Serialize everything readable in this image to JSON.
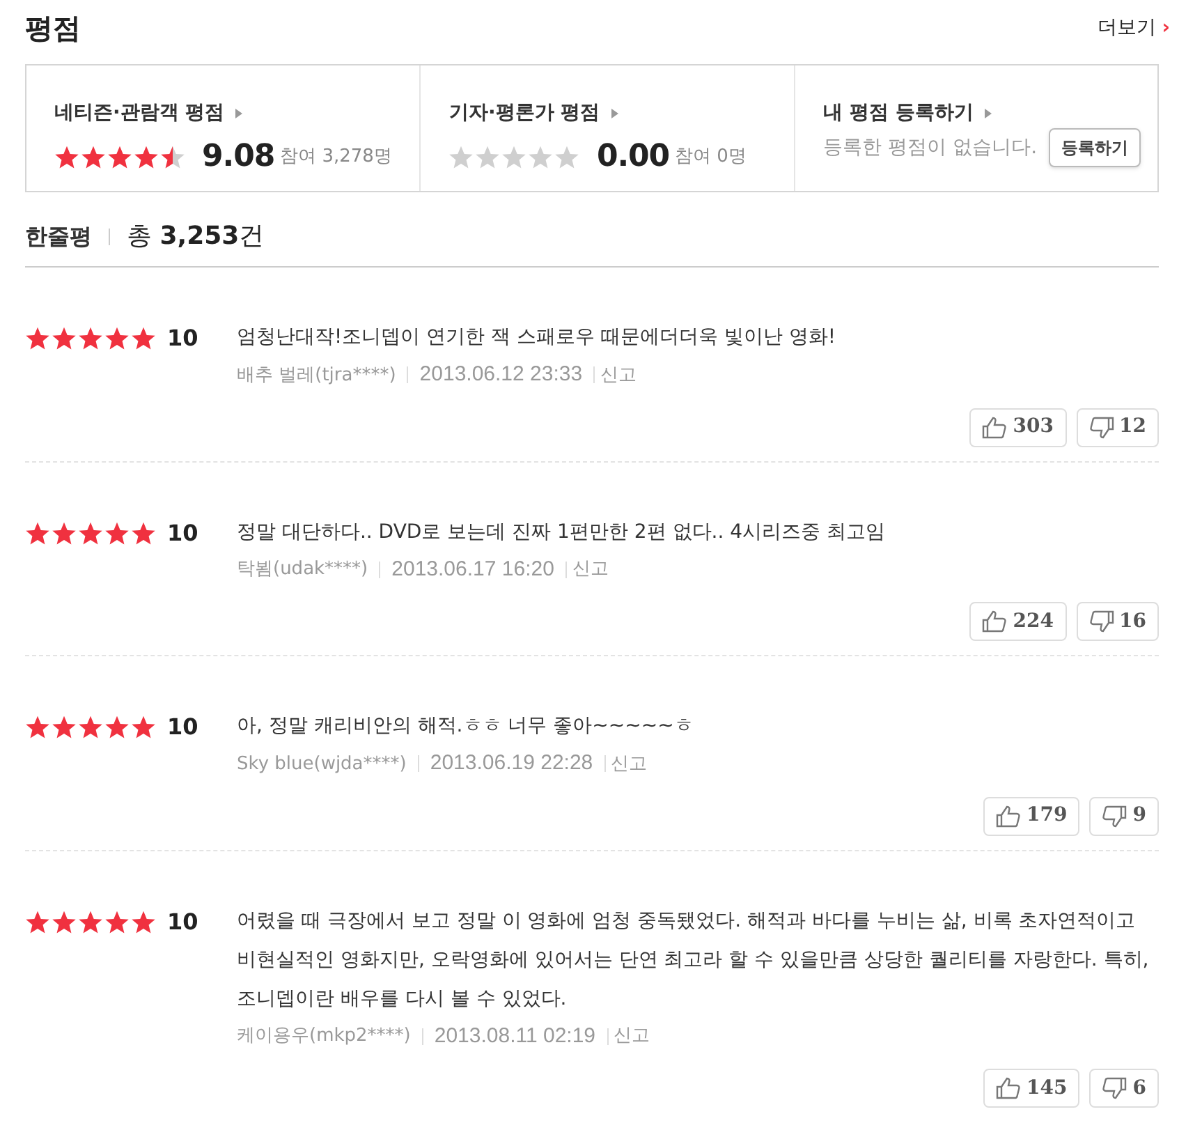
{
  "header": {
    "title": "평점",
    "more_link": "더보기",
    "more_arrow": "›"
  },
  "summary": [
    {
      "kind": "score",
      "title": "네티즌·관람객 평점",
      "stars": 4.5,
      "score": "9.08",
      "participants": "참여 3,278명"
    },
    {
      "kind": "score",
      "title": "기자·평론가 평점",
      "stars": 0,
      "score": "0.00",
      "participants": "참여 0명"
    },
    {
      "kind": "register",
      "title": "내 평점 등록하기",
      "message": "등록한 평점이 없습니다.",
      "button": "등록하기"
    }
  ],
  "reviews_header": {
    "title": "한줄평",
    "total_prefix": "총",
    "total": "3,253",
    "total_suffix": "건"
  },
  "reviews": [
    {
      "stars": 5,
      "score": "10",
      "text": "엄청난대작!조니뎁이 연기한 잭 스패로우 때문에더더욱 빛이난 영화!",
      "author": "배추 벌레(tjra****)",
      "date": "2013.06.12 23:33",
      "report": "신고",
      "likes": "303",
      "dislikes": "12"
    },
    {
      "stars": 5,
      "score": "10",
      "text": "정말 대단하다.. DVD로 보는데 진짜 1편만한 2편 없다.. 4시리즈중 최고임",
      "author": "탁뵘(udak****)",
      "date": "2013.06.17 16:20",
      "report": "신고",
      "likes": "224",
      "dislikes": "16"
    },
    {
      "stars": 5,
      "score": "10",
      "text": "아, 정말 캐리비안의 해적.ㅎㅎ 너무 좋아~~~~~ㅎ",
      "author": "Sky blue(wjda****)",
      "date": "2013.06.19 22:28",
      "report": "신고",
      "likes": "179",
      "dislikes": "9"
    },
    {
      "stars": 5,
      "score": "10",
      "text": "어렸을 때 극장에서 보고 정말 이 영화에 엄청 중독됐었다. 해적과 바다를 누비는 삶, 비록 초자연적이고 비현실적인 영화지만, 오락영화에 있어서는 단연 최고라 할 수 있을만큼 상당한 퀄리티를 자랑한다. 특히, 조니뎁이란 배우를 다시 볼 수 있었다.",
      "author": "케이용우(mkp2****)",
      "date": "2013.08.11 02:19",
      "report": "신고",
      "likes": "145",
      "dislikes": "6"
    }
  ]
}
